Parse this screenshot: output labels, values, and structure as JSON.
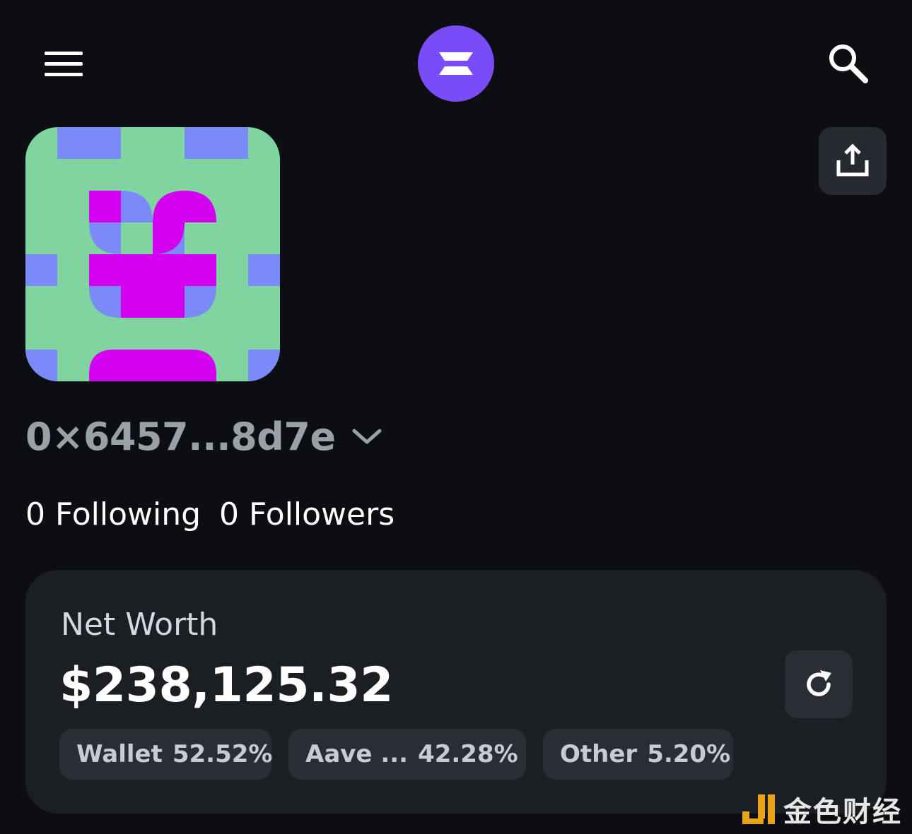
{
  "header": {
    "menu_icon": "hamburger-menu-icon",
    "logo_icon": "zerion-logo-icon",
    "search_icon": "search-icon",
    "logo_color": "#7a4cf7"
  },
  "profile": {
    "avatar_description": "generated-pattern-avatar",
    "avatar_colors": {
      "background": "#80d4a0",
      "blue": "#7b8af7",
      "magenta": "#d400f0"
    },
    "share_icon": "share-upload-icon",
    "address": "0×6457...8d7e",
    "address_dropdown_icon": "chevron-down-icon",
    "following_label": "0 Following",
    "followers_label": "0 Followers"
  },
  "net_worth": {
    "label": "Net Worth",
    "value": "$238,125.32",
    "refresh_icon": "refresh-icon",
    "breakdown": [
      {
        "name": "Wallet",
        "percent": "52.52%"
      },
      {
        "name": "Aave ...",
        "percent": "42.28%"
      },
      {
        "name": "Other",
        "percent": "5.20%"
      }
    ]
  },
  "watermark": {
    "text": "金色财经",
    "accent": "#e8a317"
  }
}
